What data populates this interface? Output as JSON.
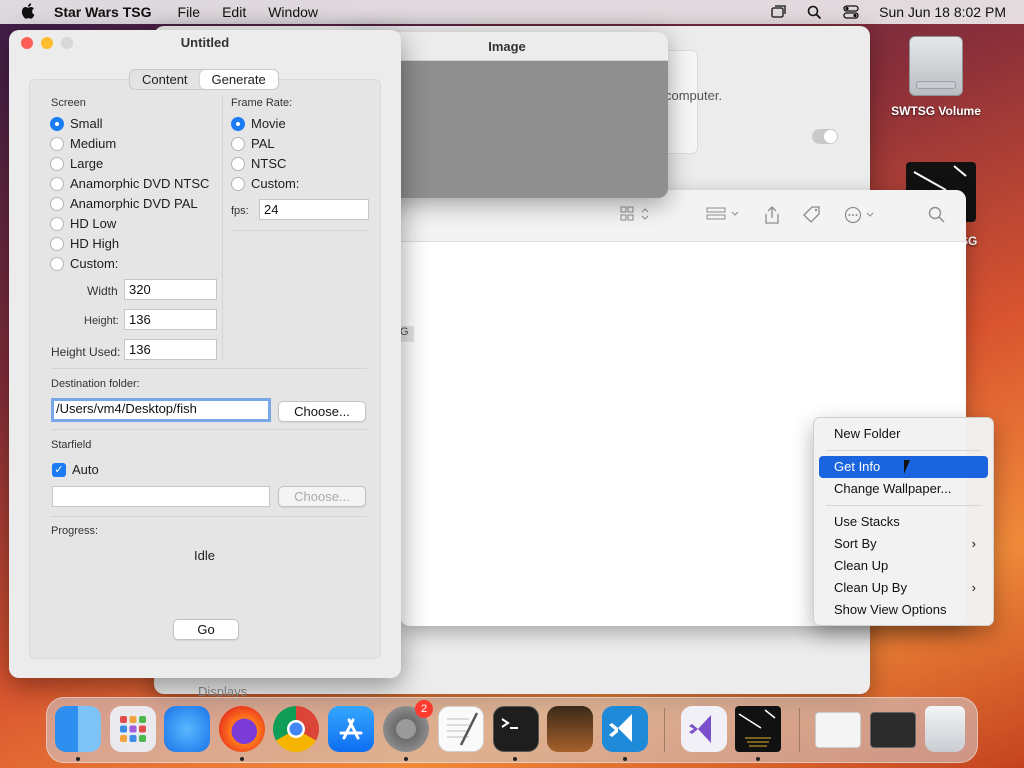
{
  "menubar": {
    "app_name": "Star Wars TSG",
    "menus": [
      "File",
      "Edit",
      "Window"
    ],
    "datetime": "Sun Jun 18  8:02 PM",
    "icons": [
      "apple-icon",
      "stage-manager-icon",
      "spotlight-icon",
      "control-center-icon"
    ]
  },
  "desktop": {
    "volume_label": "SWTSG Volume",
    "app_icon_label_fragment": "SG"
  },
  "settings_window": {
    "text_fragment": "computer.",
    "sidebar_fragment": "Displays"
  },
  "finder_window": {
    "tag_fragment": "G"
  },
  "image_window": {
    "title": "Image"
  },
  "main_window": {
    "title": "Untitled",
    "tabs": [
      {
        "label": "Content",
        "active": false
      },
      {
        "label": "Generate",
        "active": true
      }
    ],
    "screen": {
      "label": "Screen",
      "options": [
        {
          "label": "Small",
          "selected": true
        },
        {
          "label": "Medium",
          "selected": false
        },
        {
          "label": "Large",
          "selected": false
        },
        {
          "label": "Anamorphic DVD NTSC",
          "selected": false
        },
        {
          "label": "Anamorphic DVD PAL",
          "selected": false
        },
        {
          "label": "HD Low",
          "selected": false
        },
        {
          "label": "HD High",
          "selected": false
        },
        {
          "label": "Custom:",
          "selected": false
        }
      ],
      "width_label": "Width",
      "width_value": "320",
      "height_label": "Height:",
      "height_value": "136",
      "height_used_label": "Height Used:",
      "height_used_value": "136"
    },
    "frame_rate": {
      "label": "Frame Rate:",
      "options": [
        {
          "label": "Movie",
          "selected": true
        },
        {
          "label": "PAL",
          "selected": false
        },
        {
          "label": "NTSC",
          "selected": false
        },
        {
          "label": "Custom:",
          "selected": false
        }
      ],
      "fps_label": "fps:",
      "fps_value": "24"
    },
    "destination": {
      "label": "Destination folder:",
      "value": "/Users/vm4/Desktop/fish",
      "choose_label": "Choose..."
    },
    "starfield": {
      "label": "Starfield",
      "auto_label": "Auto",
      "auto_checked": true,
      "path_value": "",
      "choose_label": "Choose..."
    },
    "progress": {
      "label": "Progress:",
      "status": "Idle"
    },
    "go_label": "Go"
  },
  "context_menu": {
    "items": [
      {
        "label": "New Folder",
        "submenu": false,
        "selected": false,
        "group": 1
      },
      {
        "label": "Get Info",
        "submenu": false,
        "selected": true,
        "group": 2
      },
      {
        "label": "Change Wallpaper...",
        "submenu": false,
        "selected": false,
        "group": 2
      },
      {
        "label": "Use Stacks",
        "submenu": false,
        "selected": false,
        "group": 3
      },
      {
        "label": "Sort By",
        "submenu": true,
        "selected": false,
        "group": 3
      },
      {
        "label": "Clean Up",
        "submenu": false,
        "selected": false,
        "group": 3
      },
      {
        "label": "Clean Up By",
        "submenu": true,
        "selected": false,
        "group": 3
      },
      {
        "label": "Show View Options",
        "submenu": false,
        "selected": false,
        "group": 3
      }
    ]
  },
  "dock": {
    "items": [
      {
        "name": "finder",
        "running": true
      },
      {
        "name": "launchpad",
        "running": false
      },
      {
        "name": "safari",
        "running": false
      },
      {
        "name": "firefox",
        "running": true
      },
      {
        "name": "chrome",
        "running": false
      },
      {
        "name": "app-store",
        "running": false
      },
      {
        "name": "system-settings",
        "running": true,
        "badge": "2"
      },
      {
        "name": "textedit",
        "running": false
      },
      {
        "name": "terminal",
        "running": true
      },
      {
        "name": "garageband",
        "running": false
      },
      {
        "name": "vscode",
        "running": true
      },
      {
        "name": "visual-studio",
        "running": false
      },
      {
        "name": "star-wars-tsg",
        "running": true
      },
      {
        "name": "downloads-stack",
        "running": false
      },
      {
        "name": "recent-stack",
        "running": false
      },
      {
        "name": "trash",
        "running": false
      }
    ]
  },
  "colors": {
    "accent": "#1b7cf5",
    "menu_highlight": "#1b64e0",
    "badge": "#ff3b30"
  }
}
